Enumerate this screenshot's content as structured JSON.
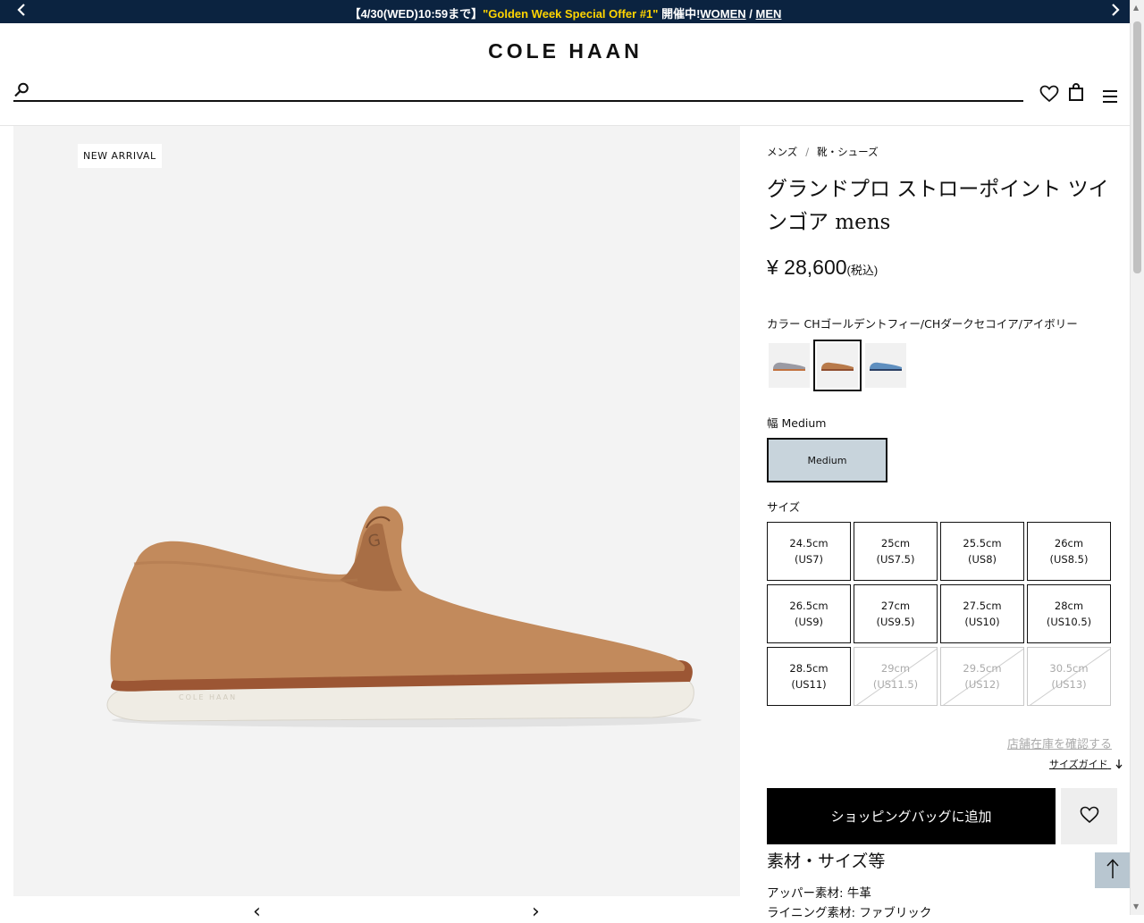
{
  "banner": {
    "date_text": "【4/30(WED)10:59まで】",
    "offer_text": "\"Golden Week Special Offer #1\"",
    "status_text": " 開催中!",
    "women_link": "WOMEN",
    "separator": " / ",
    "men_link": "MEN",
    "prev_icon": "chevron-left-icon",
    "next_icon": "chevron-right-icon",
    "bg_color": "#0b2340",
    "highlight_color": "#ffd400"
  },
  "header": {
    "logo": "COLE HAAN",
    "search_placeholder": "",
    "icons": [
      "search-icon",
      "heart-icon",
      "bag-icon",
      "menu-icon"
    ]
  },
  "product_image": {
    "badge": "NEW ARRIVAL",
    "gallery_prev": "‹",
    "gallery_next": "›"
  },
  "breadcrumb": {
    "items": [
      "メンズ",
      "靴・シューズ"
    ],
    "separator": "/"
  },
  "product": {
    "title": "グランドプロ ストローポイント ツインゴア mens",
    "price": "¥ 28,600",
    "tax_note": "(税込)",
    "color_label": "カラー",
    "color_value": "CHゴールデントフィー/CHダークセコイア/アイボリー",
    "swatches": [
      {
        "name": "grey",
        "color": "#9a9aa3"
      },
      {
        "name": "tan",
        "color": "#b87a4b",
        "selected": true
      },
      {
        "name": "blue",
        "color": "#5f8fbf"
      }
    ],
    "width_label": "幅",
    "width_value": "Medium",
    "width_option": "Medium",
    "size_label": "サイズ",
    "sizes": [
      {
        "cm": "24.5cm",
        "us": "(US7)",
        "available": true
      },
      {
        "cm": "25cm",
        "us": "(US7.5)",
        "available": true
      },
      {
        "cm": "25.5cm",
        "us": "(US8)",
        "available": true
      },
      {
        "cm": "26cm",
        "us": "(US8.5)",
        "available": true
      },
      {
        "cm": "26.5cm",
        "us": "(US9)",
        "available": true
      },
      {
        "cm": "27cm",
        "us": "(US9.5)",
        "available": true
      },
      {
        "cm": "27.5cm",
        "us": "(US10)",
        "available": true
      },
      {
        "cm": "28cm",
        "us": "(US10.5)",
        "available": true
      },
      {
        "cm": "28.5cm",
        "us": "(US11)",
        "available": true
      },
      {
        "cm": "29cm",
        "us": "(US11.5)",
        "available": false
      },
      {
        "cm": "29.5cm",
        "us": "(US12)",
        "available": false
      },
      {
        "cm": "30.5cm",
        "us": "(US13)",
        "available": false
      }
    ],
    "store_stock_link": "店舗在庫を確認する",
    "size_guide_link": "サイズガイド",
    "size_guide_icon": "arrow-down-icon",
    "add_to_bag": "ショッピングバッグに追加",
    "favorite_icon": "heart-icon"
  },
  "materials": {
    "title": "素材・サイズ等",
    "lines": [
      "アッパー素材: 牛革",
      "ライニング素材: ファブリック"
    ]
  },
  "back_to_top_icon": "arrow-up-icon"
}
